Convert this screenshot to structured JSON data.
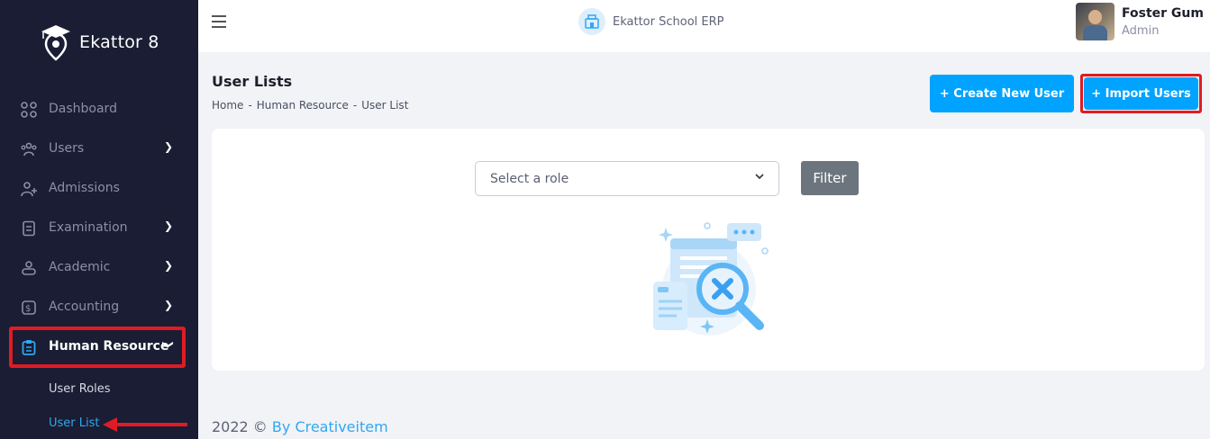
{
  "sidebar": {
    "logo_text": "Ekattor 8",
    "items": [
      {
        "label": "Dashboard",
        "icon": "dashboard-icon"
      },
      {
        "label": "Users",
        "icon": "users-icon"
      },
      {
        "label": "Admissions",
        "icon": "admission-icon"
      },
      {
        "label": "Examination",
        "icon": "exam-icon"
      },
      {
        "label": "Academic",
        "icon": "academic-icon"
      },
      {
        "label": "Accounting",
        "icon": "accounting-icon"
      },
      {
        "label": "Human Resource",
        "icon": "clipboard-icon"
      }
    ],
    "submenu": [
      {
        "label": "User Roles"
      },
      {
        "label": "User List"
      }
    ]
  },
  "header": {
    "brand": "Ekattor School ERP",
    "profile_name": "Foster Gum",
    "profile_role": "Admin"
  },
  "page": {
    "title": "User Lists",
    "breadcrumbs": [
      "Home",
      "-",
      "Human Resource",
      "-",
      "User List"
    ],
    "create_button": "+ Create New User",
    "import_button": "+ Import Users"
  },
  "filter": {
    "select_placeholder": "Select a role",
    "filter_button": "Filter"
  },
  "footer": {
    "prefix": "2022 ©",
    "link": "By Creativeitem"
  },
  "colors": {
    "accent": "#00a3ff",
    "sidebar_bg": "#1a1d33",
    "highlight": "#e01b24"
  }
}
